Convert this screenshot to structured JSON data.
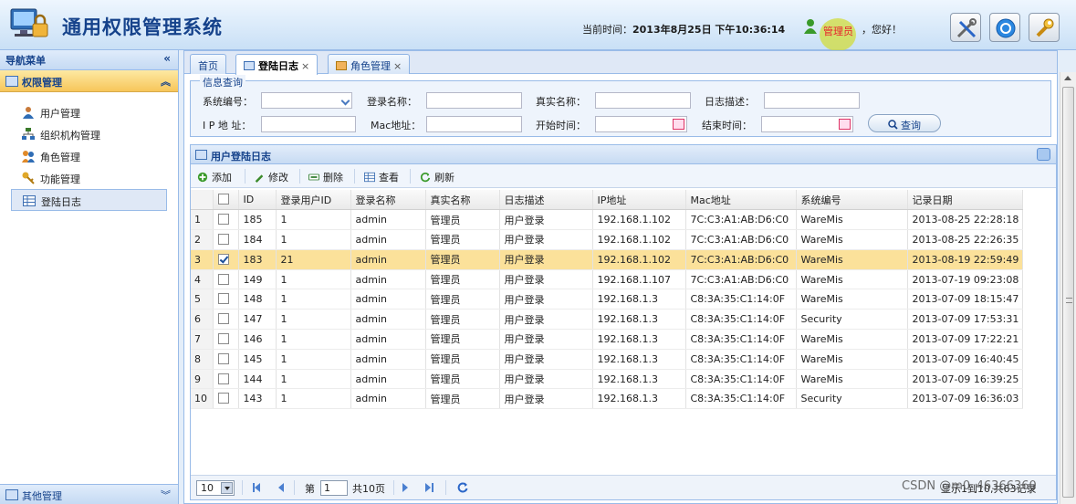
{
  "header": {
    "app_title": "通用权限管理系统",
    "time_label": "当前时间：",
    "time_value": "2013年8月25日 下午10:36:14",
    "user_name": "管理员",
    "greeting": "，您好！"
  },
  "sidebar": {
    "title": "导航菜单",
    "group": "权限管理",
    "items": [
      {
        "label": "用户管理",
        "icon": "user-icon"
      },
      {
        "label": "组织机构管理",
        "icon": "org-icon"
      },
      {
        "label": "角色管理",
        "icon": "role-icon"
      },
      {
        "label": "功能管理",
        "icon": "key-icon"
      },
      {
        "label": "登陆日志",
        "icon": "table-icon"
      }
    ],
    "footer": "其他管理"
  },
  "tabs": [
    {
      "label": "首页"
    },
    {
      "label": "登陆日志",
      "active": true
    },
    {
      "label": "角色管理"
    }
  ],
  "query": {
    "legend": "信息查询",
    "labels": {
      "system_no": "系统编号：",
      "login_name": "登录名称：",
      "real_name": "真实名称：",
      "log_desc": "日志描述：",
      "ip": "I P 地 址：",
      "mac": "Mac地址：",
      "start_time": "开始时间：",
      "end_time": "结束时间："
    },
    "search_button": "查询"
  },
  "grid": {
    "title": "用户登陆日志",
    "toolbar": [
      "添加",
      "修改",
      "删除",
      "查看",
      "刷新"
    ],
    "columns": [
      "ID",
      "登录用户ID",
      "登录名称",
      "真实名称",
      "日志描述",
      "IP地址",
      "Mac地址",
      "系统编号",
      "记录日期"
    ],
    "rows": [
      {
        "n": "1",
        "id": "185",
        "uid": "1",
        "login": "admin",
        "real": "管理员",
        "desc": "用户登录",
        "ip": "192.168.1.102",
        "mac": "7C:C3:A1:AB:D6:C0",
        "sys": "WareMis",
        "date": "2013-08-25 22:28:18"
      },
      {
        "n": "2",
        "id": "184",
        "uid": "1",
        "login": "admin",
        "real": "管理员",
        "desc": "用户登录",
        "ip": "192.168.1.102",
        "mac": "7C:C3:A1:AB:D6:C0",
        "sys": "WareMis",
        "date": "2013-08-25 22:26:35"
      },
      {
        "n": "3",
        "id": "183",
        "uid": "21",
        "login": "admin",
        "real": "管理员",
        "desc": "用户登录",
        "ip": "192.168.1.102",
        "mac": "7C:C3:A1:AB:D6:C0",
        "sys": "WareMis",
        "date": "2013-08-19 22:59:49",
        "selected": true
      },
      {
        "n": "4",
        "id": "149",
        "uid": "1",
        "login": "admin",
        "real": "管理员",
        "desc": "用户登录",
        "ip": "192.168.1.107",
        "mac": "7C:C3:A1:AB:D6:C0",
        "sys": "WareMis",
        "date": "2013-07-19 09:23:08"
      },
      {
        "n": "5",
        "id": "148",
        "uid": "1",
        "login": "admin",
        "real": "管理员",
        "desc": "用户登录",
        "ip": "192.168.1.3",
        "mac": "C8:3A:35:C1:14:0F",
        "sys": "WareMis",
        "date": "2013-07-09 18:15:47"
      },
      {
        "n": "6",
        "id": "147",
        "uid": "1",
        "login": "admin",
        "real": "管理员",
        "desc": "用户登录",
        "ip": "192.168.1.3",
        "mac": "C8:3A:35:C1:14:0F",
        "sys": "Security",
        "date": "2013-07-09 17:53:31"
      },
      {
        "n": "7",
        "id": "146",
        "uid": "1",
        "login": "admin",
        "real": "管理员",
        "desc": "用户登录",
        "ip": "192.168.1.3",
        "mac": "C8:3A:35:C1:14:0F",
        "sys": "WareMis",
        "date": "2013-07-09 17:22:21"
      },
      {
        "n": "8",
        "id": "145",
        "uid": "1",
        "login": "admin",
        "real": "管理员",
        "desc": "用户登录",
        "ip": "192.168.1.3",
        "mac": "C8:3A:35:C1:14:0F",
        "sys": "WareMis",
        "date": "2013-07-09 16:40:45"
      },
      {
        "n": "9",
        "id": "144",
        "uid": "1",
        "login": "admin",
        "real": "管理员",
        "desc": "用户登录",
        "ip": "192.168.1.3",
        "mac": "C8:3A:35:C1:14:0F",
        "sys": "WareMis",
        "date": "2013-07-09 16:39:25"
      },
      {
        "n": "10",
        "id": "143",
        "uid": "1",
        "login": "admin",
        "real": "管理员",
        "desc": "用户登录",
        "ip": "192.168.1.3",
        "mac": "C8:3A:35:C1:14:0F",
        "sys": "Security",
        "date": "2013-07-09 16:36:03"
      }
    ]
  },
  "pager": {
    "page_size": "10",
    "page_label": "第",
    "page_value": "1",
    "total_label": "共10页",
    "info": "显示1到10,共63记录"
  },
  "watermark": "CSDN @m0_46366360",
  "colors": {
    "accent": "#15428b",
    "selected_row": "#fbe19a",
    "border": "#99bbe8"
  }
}
